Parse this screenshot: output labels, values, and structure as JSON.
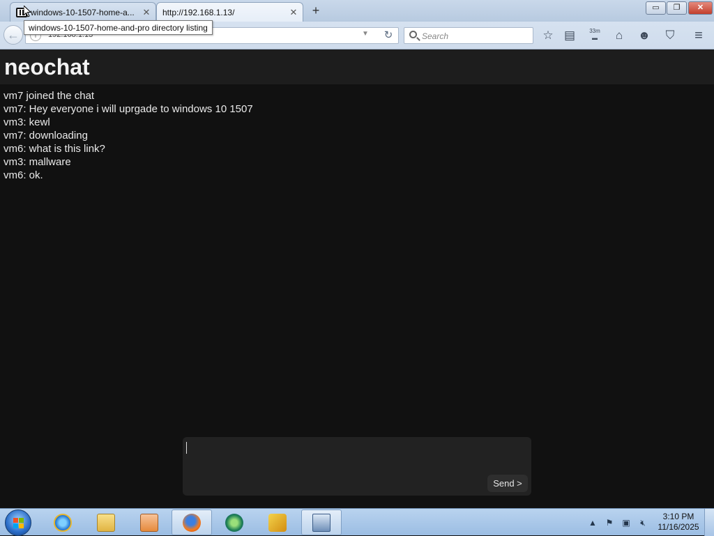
{
  "browser": {
    "tabs": [
      {
        "title": "windows-10-1507-home-a...",
        "state": "inactive"
      },
      {
        "title": "http://192.168.1.13/",
        "state": "active"
      }
    ],
    "tooltip": "windows-10-1507-home-and-pro directory listing",
    "url": "192.168.1.13",
    "search_placeholder": "Search",
    "speed_badge": "33m",
    "window_controls": {
      "minimize": "▭",
      "maximize": "❐",
      "close": "✕"
    },
    "toolbar_icons": [
      "bookmark-star-icon",
      "library-icon",
      "speed-icon",
      "home-icon",
      "hello-icon",
      "pocket-icon",
      "menu-icon"
    ]
  },
  "chat": {
    "title": "neochat",
    "messages": [
      "vm7 joined the chat",
      "vm7: Hey everyone i will uprgade to windows 10 1507",
      "vm3: kewl",
      "vm7: downloading",
      "vm6: what is this link?",
      "vm3: mallware",
      "vm6: ok."
    ],
    "input_value": "",
    "send_label": "Send >"
  },
  "taskbar": {
    "apps": [
      "start-button",
      "internet-explorer-icon",
      "file-explorer-icon",
      "media-player-icon",
      "firefox-icon",
      "globe-app-icon",
      "winamp-icon",
      "network-icon"
    ],
    "clock": {
      "time": "3:10 PM",
      "date": "11/16/2025"
    }
  },
  "colors": {
    "page_bg": "#111111",
    "header_bg": "#1d1d1d",
    "text": "#eaeaea"
  }
}
